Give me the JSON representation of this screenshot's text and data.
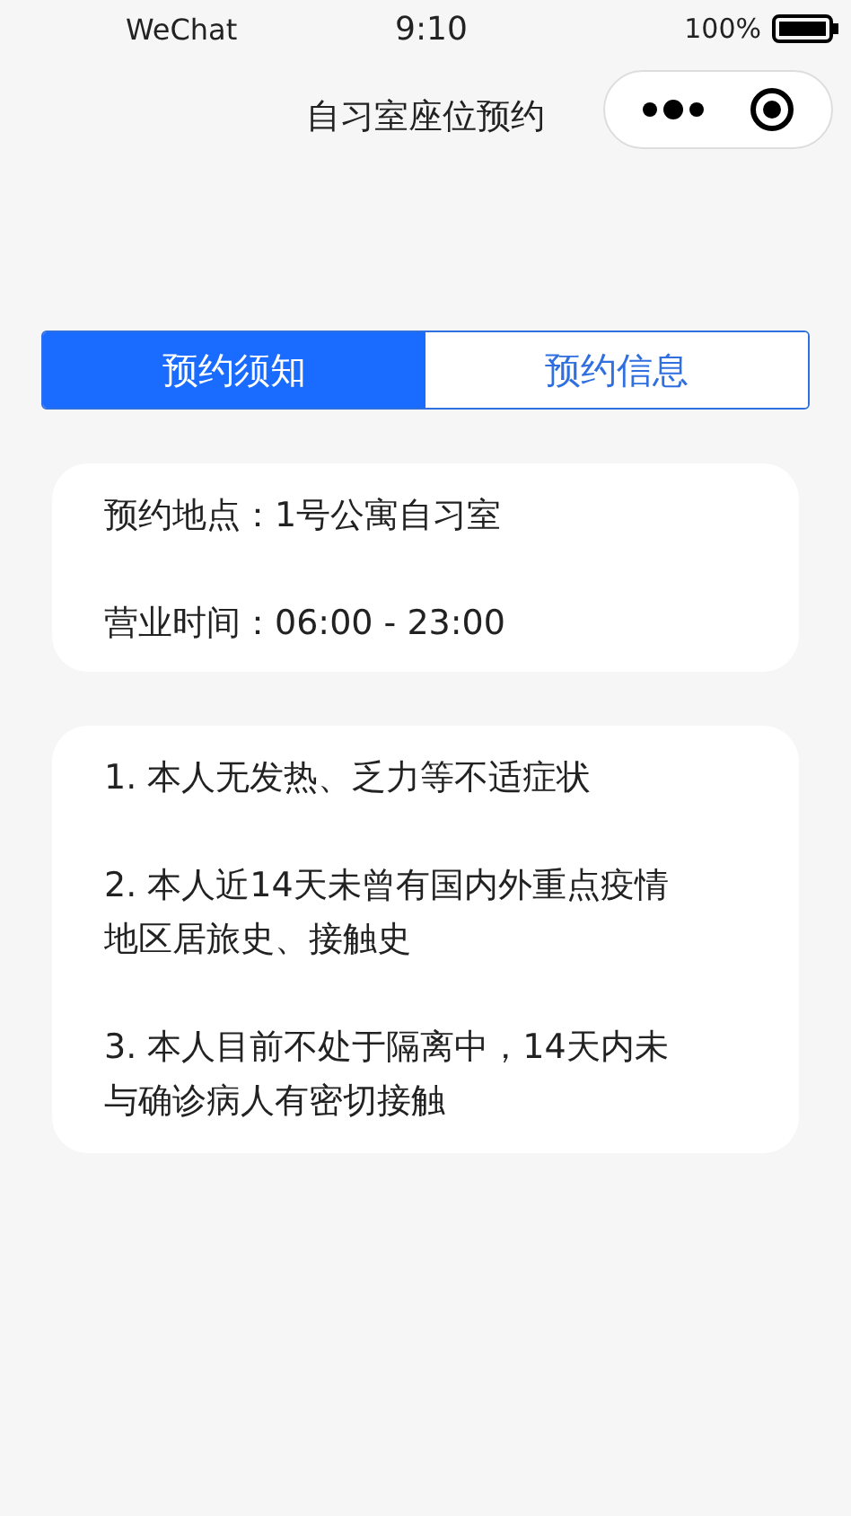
{
  "status_bar": {
    "carrier": "WeChat",
    "time": "9:10",
    "battery": "100%"
  },
  "nav_bar": {
    "title": "自习室座位预约"
  },
  "tabs": [
    {
      "label": "预约须知",
      "selected": true
    },
    {
      "label": "预约信息",
      "selected": false
    }
  ],
  "info_card": {
    "lines": [
      "预约地点：1号公寓自习室",
      "营业时间：06:00 - 23:00"
    ]
  },
  "notice_card": {
    "items": [
      "1. 本人无发热、乏力等不适症状",
      "2. 本人近14天未曾有国内外重点疫情地区居旅史、接触史",
      "3. 本人目前不处于隔离中，14天内未与确诊病人有密切接触"
    ]
  }
}
